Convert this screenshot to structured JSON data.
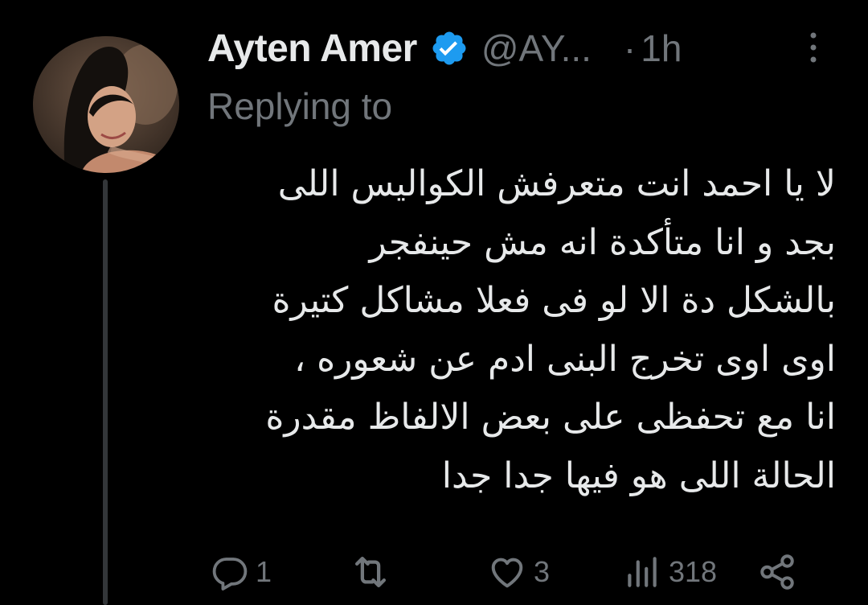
{
  "tweet": {
    "author": {
      "display_name": "Ayten Amer",
      "verified": true,
      "handle": "@AY...",
      "avatar_icon": "profile-photo"
    },
    "separator": "·",
    "time": "1h",
    "replying_to": "Replying to",
    "text_lines": [
      "لا يا احمد انت متعرفش الكواليس اللى",
      "بجد و انا متأكدة انه مش حينفجر",
      "بالشكل دة الا لو فى فعلا مشاكل كتيرة",
      "اوى اوى تخرج البنى ادم عن شعوره ،",
      "انا مع تحفظى على بعض الالفاظ مقدرة",
      "الحالة اللى هو فيها جدا جدا"
    ],
    "actions": {
      "reply": {
        "icon": "reply-icon",
        "count": "1"
      },
      "retweet": {
        "icon": "retweet-icon",
        "count": ""
      },
      "like": {
        "icon": "heart-icon",
        "count": "3"
      },
      "views": {
        "icon": "views-icon",
        "count": "318"
      },
      "share": {
        "icon": "share-icon",
        "count": ""
      }
    }
  },
  "colors": {
    "background": "#000000",
    "text_primary": "#e7e9ea",
    "text_secondary": "#71767b",
    "verified_blue": "#1d9bf0",
    "thread_line": "#333639"
  }
}
